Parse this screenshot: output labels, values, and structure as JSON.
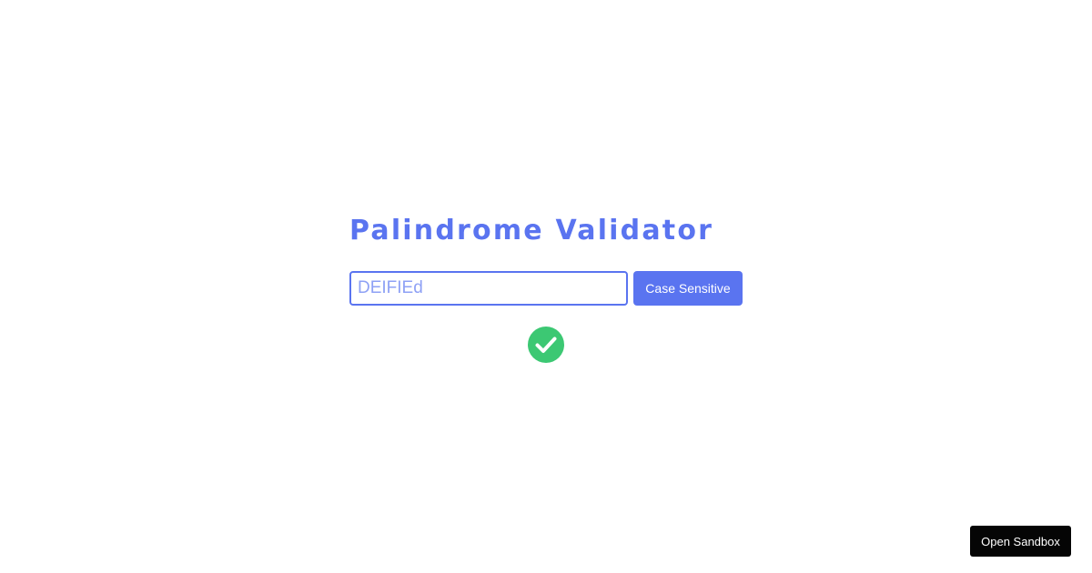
{
  "app": {
    "title": "Palindrome Validator"
  },
  "input": {
    "value": "DEIFIEd"
  },
  "case_toggle": {
    "label": "Case Sensitive"
  },
  "result": {
    "status": "valid",
    "icon": "check-circle-icon",
    "color": "#3cc873"
  },
  "footer": {
    "sandbox_label": "Open Sandbox"
  },
  "theme": {
    "accent": "#5a74f0",
    "success": "#3cc873",
    "dark_button": "#050505"
  }
}
